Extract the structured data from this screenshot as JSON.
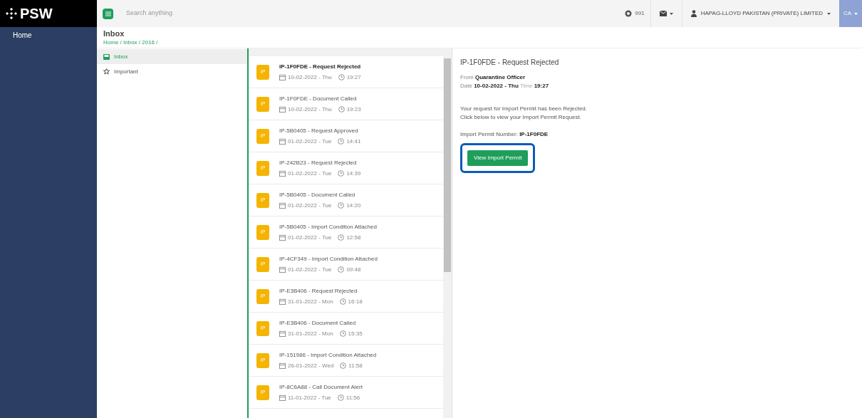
{
  "sidebar": {
    "logo": "PSW",
    "items": [
      {
        "label": "Home",
        "selected": true
      }
    ]
  },
  "topbar": {
    "search": {
      "placeholder": "Search anything"
    },
    "count": "991",
    "account": "HAPAG-LLOYD PAKISTAN (PRIVATE) LIMITED",
    "user": "CA"
  },
  "header": {
    "title": "Inbox",
    "breadcrumb": "Home / Inbox / 2016 /"
  },
  "folders": [
    {
      "label": "Inbox",
      "kind": "inbox",
      "selected": true
    },
    {
      "label": "Important",
      "kind": "important",
      "selected": false
    }
  ],
  "messages": [
    {
      "badge": "IP",
      "subject": "IP-1F0FDE - Request Rejected",
      "date": "10-02-2022 - Thu",
      "time": "19:27",
      "unread": true
    },
    {
      "badge": "IP",
      "subject": "IP-1F0FDE - Document Called",
      "date": "10-02-2022 - Thu",
      "time": "19:23",
      "unread": false
    },
    {
      "badge": "IP",
      "subject": "IP-5B0405 - Request Approved",
      "date": "01-02-2022 - Tue",
      "time": "14:41",
      "unread": false
    },
    {
      "badge": "IP",
      "subject": "IP-242B23 - Request Rejected",
      "date": "01-02-2022 - Tue",
      "time": "14:39",
      "unread": false
    },
    {
      "badge": "IP",
      "subject": "IP-5B0405 - Document Called",
      "date": "01-02-2022 - Tue",
      "time": "14:20",
      "unread": false
    },
    {
      "badge": "IP",
      "subject": "IP-5B0405 - Import Condition Attached",
      "date": "01-02-2022 - Tue",
      "time": "12:58",
      "unread": false
    },
    {
      "badge": "IP",
      "subject": "IP-4CF349 - Import Condition Attached",
      "date": "01-02-2022 - Tue",
      "time": "09:48",
      "unread": false
    },
    {
      "badge": "IP",
      "subject": "IP-E3B406 - Request Rejected",
      "date": "31-01-2022 - Mon",
      "time": "16:18",
      "unread": false
    },
    {
      "badge": "IP",
      "subject": "IP-E3B406 - Document Called",
      "date": "31-01-2022 - Mon",
      "time": "15:35",
      "unread": false
    },
    {
      "badge": "IP",
      "subject": "IP-151986 - Import Condition Attached",
      "date": "26-01-2022 - Wed",
      "time": "11:58",
      "unread": false
    },
    {
      "badge": "IP",
      "subject": "IP-8C6A88 - Call Document Alert",
      "date": "11-01-2022 - Tue",
      "time": "11:56",
      "unread": false
    }
  ],
  "detail": {
    "title": "IP-1F0FDE - Request Rejected",
    "from_label": "From",
    "from": "Quarantine Officer",
    "date_label": "Date",
    "date": "10-02-2022 - Thu",
    "time_label": "Time",
    "time": "19:27",
    "body": [
      "Your request for Import Permit has been Rejected.",
      "Click below to view your Import Permit Request."
    ],
    "permit_label": "Import Permit Number:",
    "permit": "IP-1F0FDE",
    "button": "View Import Permit",
    "highlighted": true
  }
}
